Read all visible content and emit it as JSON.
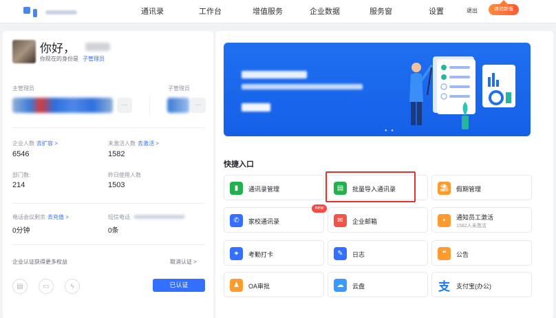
{
  "nav": {
    "items": [
      "通讯录",
      "工作台",
      "增值服务",
      "企业数据",
      "服务窗",
      "设置"
    ],
    "logout": "退出",
    "upgrade": "体验新版"
  },
  "profile": {
    "greeting": "你好，",
    "identity_label": "你现在的身份是",
    "identity_role": "子管理员"
  },
  "admins": {
    "main_label": "主管理员",
    "sub_label": "子管理员",
    "more": "···"
  },
  "stats": {
    "employees_label": "企业人数",
    "employees_link": "去扩容 >",
    "employees_value": "6546",
    "inactive_label": "未激活人数",
    "inactive_link": "去激活 >",
    "inactive_value": "1582",
    "depts_label": "部门数:",
    "depts_value": "214",
    "yesterday_label": "昨日使用人数",
    "yesterday_value": "1503",
    "phone_label": "电话会议剩余",
    "phone_link": "去充值 >",
    "phone_value": "0分钟",
    "sms_label": "短信电话",
    "sms_value": "0条"
  },
  "certification": {
    "text": "企业认证获得更多权益",
    "cancel": "取消认证 >",
    "status": "已认证"
  },
  "quick": {
    "title": "快捷入口",
    "new_badge": "new",
    "items": [
      {
        "label": "通讯录管理",
        "color": "#22b14c"
      },
      {
        "label": "批量导入通讯录",
        "color": "#22b14c"
      },
      {
        "label": "假期管理",
        "color": "#ff9a2e"
      },
      {
        "label": "家校通讯录",
        "color": "#3370ff"
      },
      {
        "label": "企业邮箱",
        "color": "#f0554a"
      },
      {
        "label": "通知员工激活",
        "sub": "1582人未激活",
        "color": "#ff9a2e"
      },
      {
        "label": "考勤打卡",
        "color": "#3370ff"
      },
      {
        "label": "日志",
        "color": "#3370ff"
      },
      {
        "label": "公告",
        "color": "#ff9a2e"
      },
      {
        "label": "OA审批",
        "color": "#ff9a2e"
      },
      {
        "label": "云盘",
        "color": "#3a9bff"
      },
      {
        "label": "支付宝(办公)",
        "color": "#1677ff"
      }
    ]
  }
}
